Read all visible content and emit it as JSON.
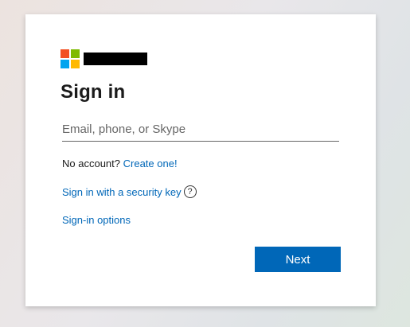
{
  "brand": {
    "logo_icon": "microsoft-logo-icon",
    "colors": {
      "red": "#f25022",
      "green": "#7fba00",
      "blue": "#00a4ef",
      "yellow": "#ffb900"
    }
  },
  "title": "Sign in",
  "input": {
    "placeholder": "Email, phone, or Skype",
    "value": ""
  },
  "no_account": {
    "text": "No account?",
    "link": "Create one!"
  },
  "security_key": {
    "link": "Sign in with a security key",
    "help_icon": "?"
  },
  "signin_options": {
    "link": "Sign-in options"
  },
  "next_button": {
    "label": "Next"
  },
  "accent_color": "#0067b8"
}
